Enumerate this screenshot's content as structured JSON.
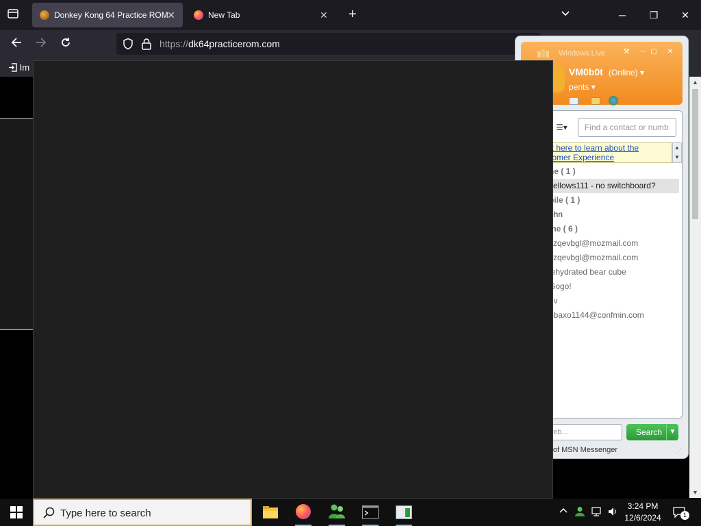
{
  "browser": {
    "tabs": [
      {
        "title": "Donkey Kong 64 Practice ROM",
        "active": true
      },
      {
        "title": "New Tab",
        "active": false
      }
    ],
    "url_scheme": "https://",
    "url_host": "dk64practicerom.com",
    "bookmark_label": "Im"
  },
  "messenger": {
    "title": "Windows Live",
    "username": "VM0b0t",
    "status": "(Online)",
    "personal_message": "pents",
    "search_placeholder": "Find a contact or numb",
    "banner_line1": "k here to learn about the",
    "banner_line2": "tomer Experience",
    "rows": [
      {
        "text": "ne ( 1 )",
        "kind": "group"
      },
      {
        "text": "yellows111 - no switchboard?",
        "kind": "sel"
      },
      {
        "text": "bile ( 1 )",
        "kind": "group"
      },
      {
        "text": "ohn",
        "kind": "contact"
      },
      {
        "text": "ine ( 6 )",
        "kind": "group"
      },
      {
        "text": "xzqevbgl@mozmail.com",
        "kind": "offline"
      },
      {
        "text": "xzqevbgl@mozmail.com",
        "kind": "offline"
      },
      {
        "text": "lehydrated bear cube",
        "kind": "offline"
      },
      {
        "text": "Gogo!",
        "kind": "offline"
      },
      {
        "text": "nv",
        "kind": "offline"
      },
      {
        "text": "obaxo1144@confmin.com",
        "kind": "offline"
      }
    ],
    "web_search_placeholder": "the web...",
    "search_button": "Search",
    "footer_text": "Future of MSN Messenger"
  },
  "taskbar": {
    "search_placeholder": "Type here to search",
    "time": "3:24 PM",
    "date": "12/6/2024",
    "notification_count": "1"
  }
}
